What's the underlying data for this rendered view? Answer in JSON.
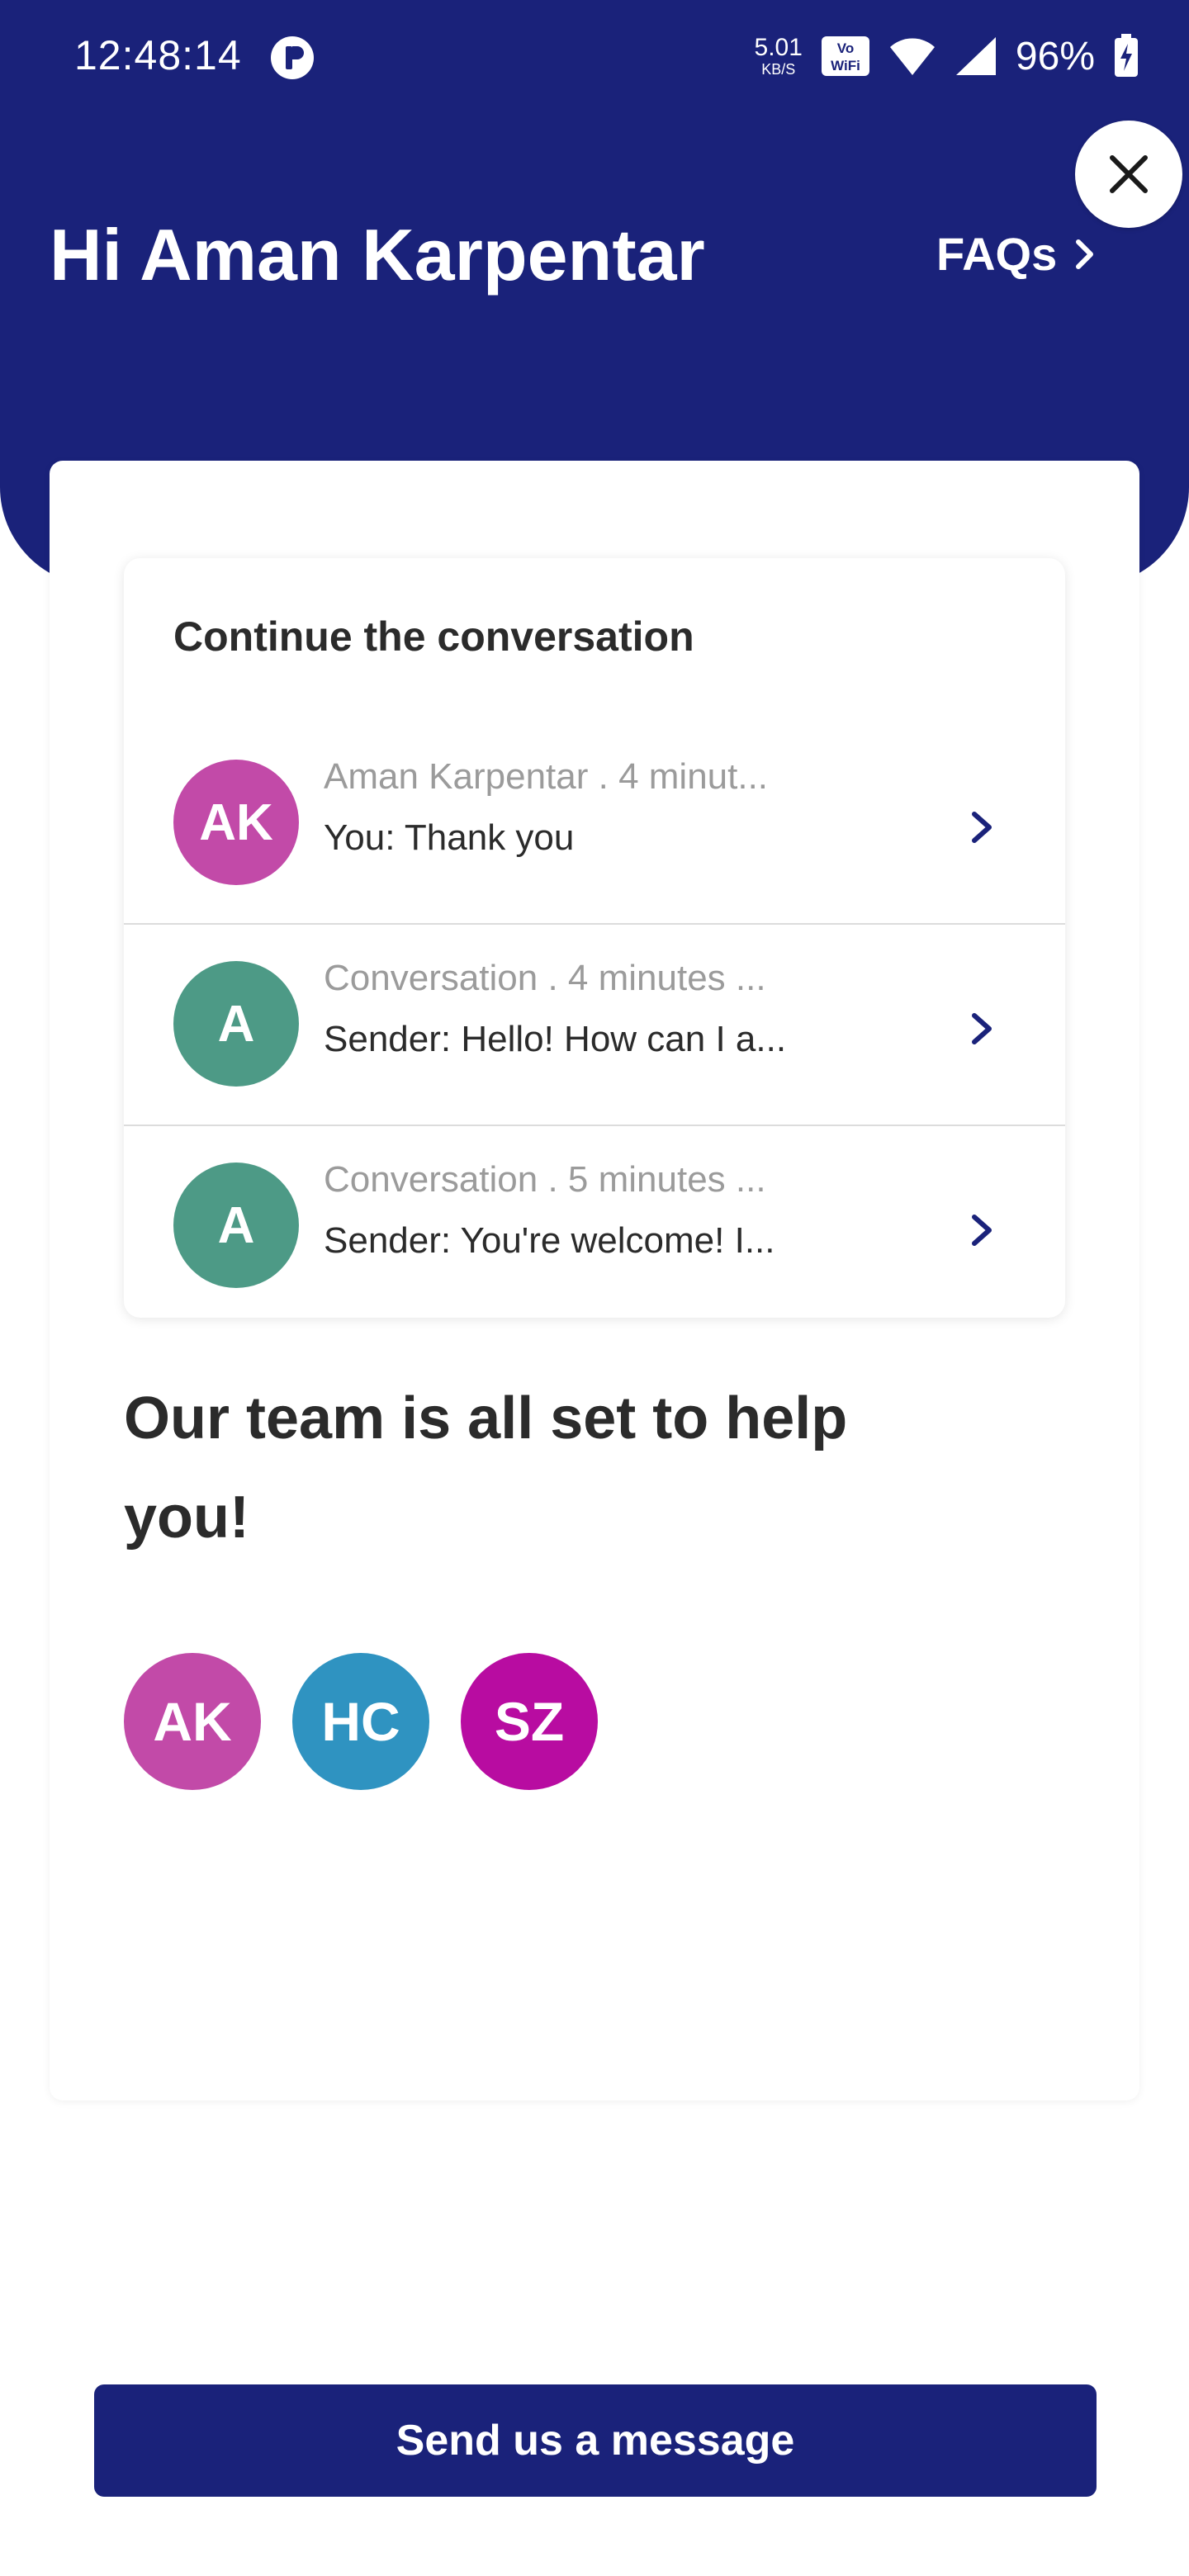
{
  "status_bar": {
    "time": "12:48:14",
    "speed_value": "5.01",
    "speed_unit": "KB/S",
    "wifi_badge": "VoWiFi",
    "battery": "96%"
  },
  "header": {
    "greeting": "Hi Aman Karpentar",
    "faqs_label": "FAQs",
    "close_icon": "close-icon",
    "background_color": "#1a227a"
  },
  "conversations": {
    "title": "Continue the conversation",
    "items": [
      {
        "initials": "AK",
        "avatar_color": "#c24aa8",
        "meta": "Aman Karpentar . 4 minut...",
        "preview": "You: Thank you"
      },
      {
        "initials": "A",
        "avatar_color": "#4d9a86",
        "meta": "Conversation . 4 minutes ...",
        "preview": "Sender: Hello! How can I a..."
      },
      {
        "initials": "A",
        "avatar_color": "#4d9a86",
        "meta": "Conversation . 5 minutes ...",
        "preview": "Sender: You're welcome! I..."
      }
    ]
  },
  "team": {
    "heading": "Our team is all set to help you!",
    "members": [
      {
        "initials": "AK",
        "color": "#c24aa8"
      },
      {
        "initials": "HC",
        "color": "#2f93c1"
      },
      {
        "initials": "SZ",
        "color": "#b80ca1"
      }
    ]
  },
  "cta": {
    "label": "Send us a message"
  }
}
